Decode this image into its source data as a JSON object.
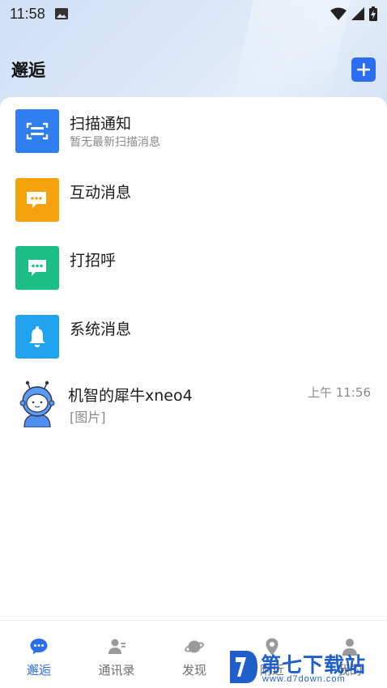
{
  "status_bar": {
    "time": "11:58"
  },
  "header": {
    "title": "邂逅"
  },
  "notifications": [
    {
      "title": "扫描通知",
      "subtitle": "暂无最新扫描消息",
      "icon": "scan-icon",
      "color": "#2f7ef2"
    },
    {
      "title": "互动消息",
      "subtitle": "",
      "icon": "chat-bubble-icon",
      "color": "#f5a20c"
    },
    {
      "title": "打招呼",
      "subtitle": "",
      "icon": "message-icon",
      "color": "#1bbf86"
    },
    {
      "title": "系统消息",
      "subtitle": "",
      "icon": "bell-icon",
      "color": "#21a4ef"
    }
  ],
  "chat": {
    "name": "机智的犀牛xneo4",
    "time": "上午 11:56",
    "preview": "[图片]"
  },
  "tabs": [
    {
      "label": "邂逅",
      "icon": "chat-tab-icon",
      "active": true
    },
    {
      "label": "通讯录",
      "icon": "contacts-icon",
      "active": false
    },
    {
      "label": "发现",
      "icon": "planet-icon",
      "active": false
    },
    {
      "label": "附近",
      "icon": "location-icon",
      "active": false
    },
    {
      "label": "我的",
      "icon": "profile-icon",
      "active": false
    }
  ],
  "watermark": {
    "title": "第七下载站",
    "url": "www.d7down.com"
  },
  "colors": {
    "accent": "#2c6ef2",
    "text_secondary": "#8a8a8a"
  }
}
